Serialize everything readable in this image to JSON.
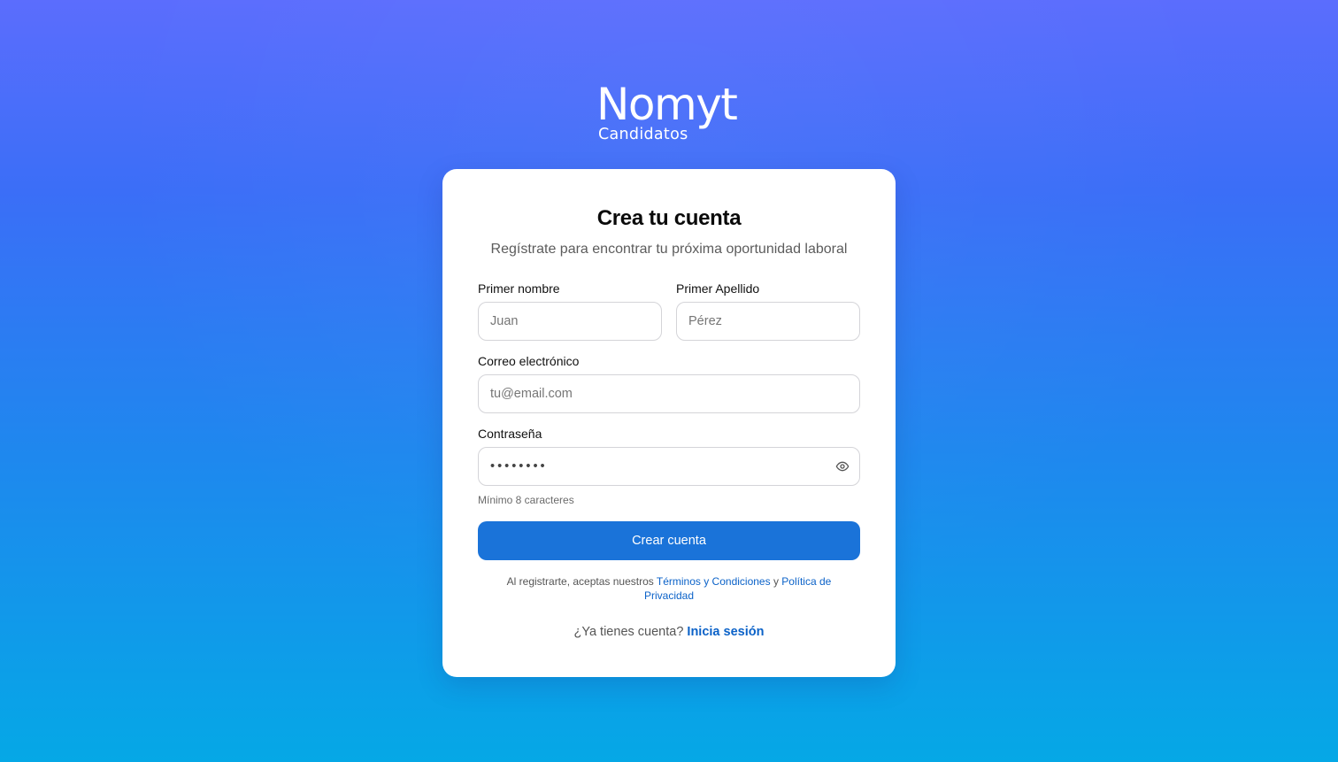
{
  "brand": {
    "name": "Nomyt",
    "subtitle": "Candidatos"
  },
  "form": {
    "title": "Crea tu cuenta",
    "subtitle": "Regístrate para encontrar tu próxima oportunidad laboral",
    "first_name": {
      "label": "Primer nombre",
      "placeholder": "Juan"
    },
    "last_name": {
      "label": "Primer Apellido",
      "placeholder": "Pérez"
    },
    "email": {
      "label": "Correo electrónico",
      "placeholder": "tu@email.com"
    },
    "password": {
      "label": "Contraseña",
      "placeholder": "••••••••",
      "hint": "Mínimo 8 caracteres",
      "toggle_icon": "eye-icon"
    },
    "submit_label": "Crear cuenta",
    "legal": {
      "prefix": "Al registrarte, aceptas nuestros",
      "terms_link": "Términos y Condiciones",
      "conjunction": "y",
      "privacy_link": "Política de Privacidad"
    },
    "signin": {
      "prompt": "¿Ya tienes cuenta?",
      "link": "Inicia sesión"
    }
  },
  "colors": {
    "primary_button": "#1a73d9",
    "link": "#0b62c8",
    "background_top": "#5b6dfd",
    "background_bottom": "#05a8e6"
  }
}
